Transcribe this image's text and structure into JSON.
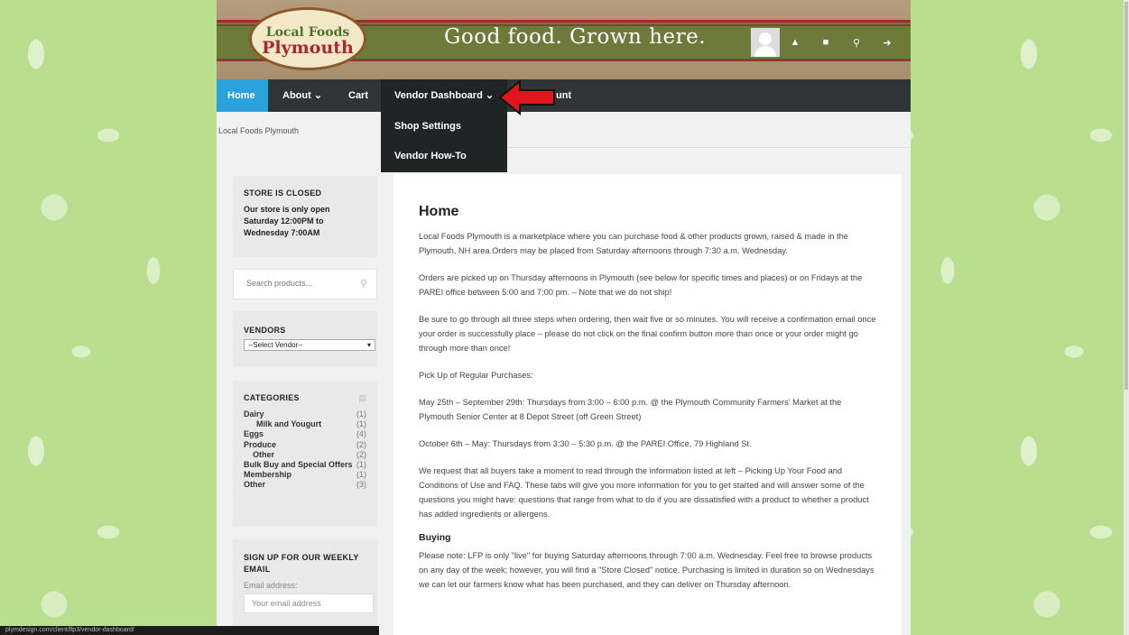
{
  "header": {
    "logo_top": "Local Foods",
    "logo_bottom": "Plymouth",
    "tagline": "Good food. Grown here."
  },
  "nav": {
    "items": [
      {
        "label": "Home",
        "active": true
      },
      {
        "label": "About ⌄"
      },
      {
        "label": "Cart"
      },
      {
        "label": "Vendor Dashboard ⌄"
      },
      {
        "label": "unt"
      }
    ],
    "dropdown": [
      "Shop Settings",
      "Vendor How-To"
    ]
  },
  "breadcrumb": "Local Foods Plymouth",
  "sidebar": {
    "store": {
      "title": "STORE IS CLOSED",
      "text": "Our store is only open Saturday 12:00PM to Wednesday 7:00AM"
    },
    "search_placeholder": "Search products...",
    "vendors": {
      "title": "VENDORS",
      "selected": "--Select Vendor--"
    },
    "categories": {
      "title": "CATEGORIES",
      "items": [
        {
          "name": "Dairy",
          "count": "(1)"
        },
        {
          "name": "Milk and Yougurt",
          "count": "(1)"
        },
        {
          "name": "Eggs",
          "count": "(4)"
        },
        {
          "name": "Produce",
          "count": "(2)"
        },
        {
          "name": "Other",
          "count": "(2)"
        },
        {
          "name": "Bulk Buy and Special Offers",
          "count": "(1)"
        },
        {
          "name": "Membership",
          "count": "(1)"
        },
        {
          "name": "Other",
          "count": "(3)"
        }
      ]
    },
    "signup": {
      "title": "SIGN UP FOR OUR WEEKLY EMAIL",
      "label": "Email address:",
      "placeholder": "Your email address"
    }
  },
  "main": {
    "title": "Home",
    "paragraphs": [
      "Local Foods Plymouth is a marketplace where you can purchase food & other products grown, raised & made in the Plymouth, NH area.Orders may be placed from Saturday afternoons through 7:30 a.m. Wednesday.",
      "Orders are picked up on Thursday afternoons in Plymouth (see below for specific times and places) or on Fridays at the PAREI office between 5:00 and 7:00 pm. – Note that we do not ship!",
      "Be sure to go through all three steps when ordering, then wait five or so minutes. You will receive a confirmation email once your order is successfully place – please do not click on the final confirm button more than once or your order might go through more than once!",
      "Pick Up of Regular Purchases:",
      "May 25th – September 29th: Thursdays from 3:00 – 6:00 p.m. @ the Plymouth Community Farmers' Market at the Plymouth Senior Center at 8 Depot Street (off Green Street)",
      "October 6th – May: Thursdays from 3:30 – 5:30 p.m. @ the PAREI Office, 79 Highland St.",
      "We request that all buyers take a moment to read through the information listed at left – Picking Up Your Food and Conditions of Use and FAQ. These tabs will give you more information for you to get started and will answer some of the questions you might have: questions that range from what to do if you are dissatisfied with a product to whether a product has added ingredients or allergens."
    ],
    "buying_title": "Buying",
    "buying_text": "Please note: LFP is only \"live\" for buying Saturday afternoons through 7:00 a.m. Wednesday. Feel free to browse products on any day of the week; however, you will find a \"Store Closed\" notice. Purchasing is limited in duration so on Wednesdays we can let our farmers know what has been purchased, and they can deliver on Thursday afternoon."
  },
  "status_url": "plymdesign.com/client/lfp3/vendor-dashboard/"
}
